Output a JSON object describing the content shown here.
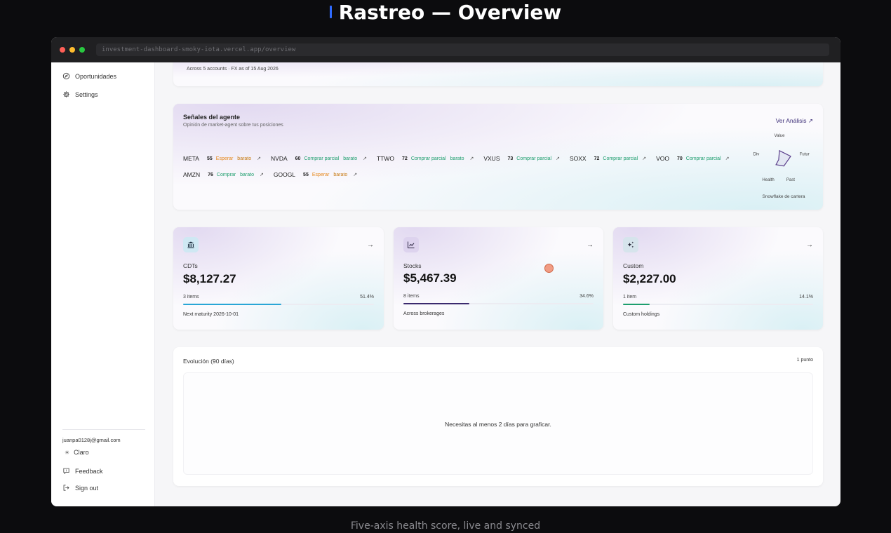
{
  "hero": {
    "title": "Rastreo — Overview"
  },
  "caption": "Five-axis health score, live and synced",
  "browser": {
    "url": "investment-dashboard-smoky-iota.vercel.app/overview"
  },
  "sidebar": {
    "items": [
      {
        "label": "Oportunidades",
        "icon": "compass-icon"
      },
      {
        "label": "Settings",
        "icon": "gear-icon"
      }
    ],
    "email": "juanpa0128j@gmail.com",
    "theme_label": "Claro",
    "feedback_label": "Feedback",
    "signout_label": "Sign out"
  },
  "summary": {
    "footnote": "Across 5 accounts · FX as of 15 Aug 2026"
  },
  "signals": {
    "title": "Señales del agente",
    "subtitle": "Opinión de market-agent sobre tus posiciones",
    "link_label": "Ver Análisis ↗",
    "row1": [
      {
        "ticker": "META",
        "score": "55",
        "action": "Esperar",
        "level": "barato",
        "tone": "orange"
      },
      {
        "ticker": "NVDA",
        "score": "60",
        "action": "Comprar parcial",
        "level": "barato",
        "tone": "green"
      },
      {
        "ticker": "TTWO",
        "score": "72",
        "action": "Comprar parcial",
        "level": "barato",
        "tone": "green"
      },
      {
        "ticker": "VXUS",
        "score": "73",
        "action": "Comprar parcial",
        "level": "",
        "tone": "green"
      },
      {
        "ticker": "SOXX",
        "score": "72",
        "action": "Comprar parcial",
        "level": "",
        "tone": "green"
      },
      {
        "ticker": "VOO",
        "score": "70",
        "action": "Comprar parcial",
        "level": "",
        "tone": "green"
      }
    ],
    "row2": [
      {
        "ticker": "AMZN",
        "score": "76",
        "action": "Comprar",
        "level": "barato",
        "tone": "green"
      },
      {
        "ticker": "GOOGL",
        "score": "55",
        "action": "Esperar",
        "level": "barato",
        "tone": "orange"
      }
    ],
    "snowflake": {
      "axes": [
        "Value",
        "Futur",
        "Past",
        "Health",
        "Div"
      ],
      "values": [
        0.55,
        0.7,
        0.45,
        0.35,
        0.05
      ],
      "caption": "Snowflake de cartera",
      "color": "#5b3f8c"
    }
  },
  "cards": [
    {
      "label": "CDTs",
      "value": "$8,127.27",
      "items": "3 items",
      "pct": "51.4%",
      "share": 0.514,
      "foot": "Next maturity 2026-10-01",
      "bar_color": "#2aa6d6",
      "icon": "bank-icon",
      "icon_bg": "#cfe8f3"
    },
    {
      "label": "Stocks",
      "value": "$5,467.39",
      "items": "8 items",
      "pct": "34.6%",
      "share": 0.346,
      "foot": "Across brokerages",
      "bar_color": "#3b2a6e",
      "icon": "line-chart-icon",
      "icon_bg": "#ddd3ee"
    },
    {
      "label": "Custom",
      "value": "$2,227.00",
      "items": "1 item",
      "pct": "14.1%",
      "share": 0.141,
      "foot": "Custom holdings",
      "bar_color": "#1e9e6e",
      "icon": "sparkles-icon",
      "icon_bg": "#d6e4ec"
    }
  ],
  "evolution": {
    "title": "Evolución (90 días)",
    "count": "1 punto",
    "empty_message": "Necesitas al menos 2 días para graficar."
  }
}
